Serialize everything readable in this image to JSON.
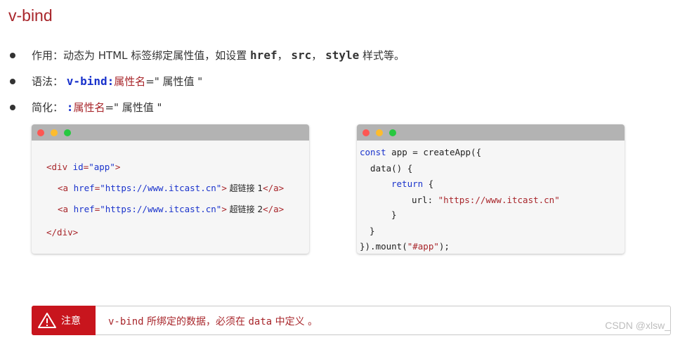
{
  "title": "v-bind",
  "bullets": [
    {
      "label": "作用：动态为 HTML 标签绑定属性值，如设置 ",
      "code1": "href",
      "sep1": "，",
      "code2": "src",
      "sep2": "，",
      "code3": "style",
      "tail": " 样式等。"
    },
    {
      "label": "语法：",
      "code": "v-bind:",
      "name": "属性名",
      "eq": "=\"",
      "value": " 属性值 \""
    },
    {
      "label": "简化：",
      "code": ":",
      "name": "属性名",
      "eq": "=\"",
      "value": " 属性值 \""
    }
  ],
  "html_panel": {
    "line1_open": "<div ",
    "line1_attr": "id",
    "line1_eq": "=",
    "line1_val": "\"app\"",
    "line1_close": ">",
    "line2_open": "<a ",
    "line2_attr": "href",
    "line2_eq": "=",
    "line2_val": "\"https://www.itcast.cn\"",
    "line2_gt": ">",
    "line2_text": " 超链接 1",
    "line2_end": "</a>",
    "line3_open": "<a ",
    "line3_attr": "href",
    "line3_eq": "=",
    "line3_val": "\"https://www.itcast.cn\"",
    "line3_gt": ">",
    "line3_text": " 超链接 2",
    "line3_end": "</a>",
    "line4": "</div>"
  },
  "js_panel": {
    "l1_kw": "const",
    "l1_rest": " app = createApp({",
    "l2": "  data() {",
    "l3_kw": "return",
    "l3_rest": " {",
    "l4_key": "url: ",
    "l4_val": "\"https://www.itcast.cn\"",
    "l5": "}",
    "l6": "}",
    "l7_a": "}).mount(",
    "l7_val": "\"#app\"",
    "l7_b": ");"
  },
  "note": {
    "badge_label": "注意",
    "code": "v-bind",
    "text_a": " 所绑定的数据，必须在 ",
    "code2": "data",
    "text_b": " 中定义 。"
  },
  "watermark": "CSDN @xlsw_",
  "colors": {
    "accent": "#a8262b",
    "code_blue": "#1a33cc",
    "badge_red": "#c8151d"
  }
}
